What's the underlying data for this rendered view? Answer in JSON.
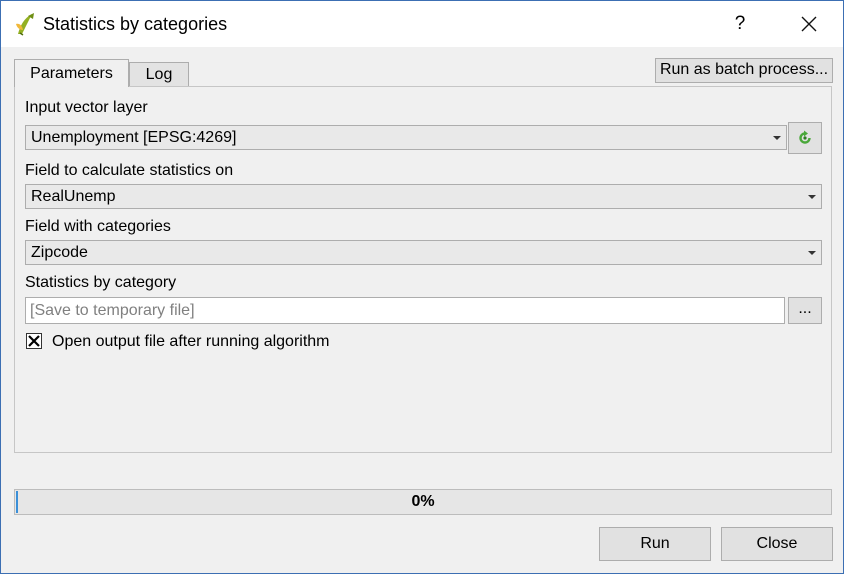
{
  "window": {
    "title": "Statistics by categories",
    "help_label": "?"
  },
  "tabs": [
    {
      "label": "Parameters",
      "active": true
    },
    {
      "label": "Log",
      "active": false
    }
  ],
  "toolbar": {
    "batch_label": "Run as batch process..."
  },
  "params": {
    "input_layer_label": "Input vector layer",
    "input_layer_value": "Unemployment [EPSG:4269]",
    "stat_field_label": "Field to calculate statistics on",
    "stat_field_value": "RealUnemp",
    "category_field_label": "Field with categories",
    "category_field_value": "Zipcode",
    "output_label": "Statistics by category",
    "output_placeholder": "[Save to temporary file]",
    "browse_label": "...",
    "open_output_label": "Open output file after running algorithm",
    "open_output_checked": true
  },
  "progress": {
    "text": "0%",
    "value": 0
  },
  "buttons": {
    "run_label": "Run",
    "close_label": "Close"
  },
  "colors": {
    "accent": "#3a8fd8",
    "refresh_icon": "#4aa83a",
    "qgis_green": "#93b023"
  }
}
